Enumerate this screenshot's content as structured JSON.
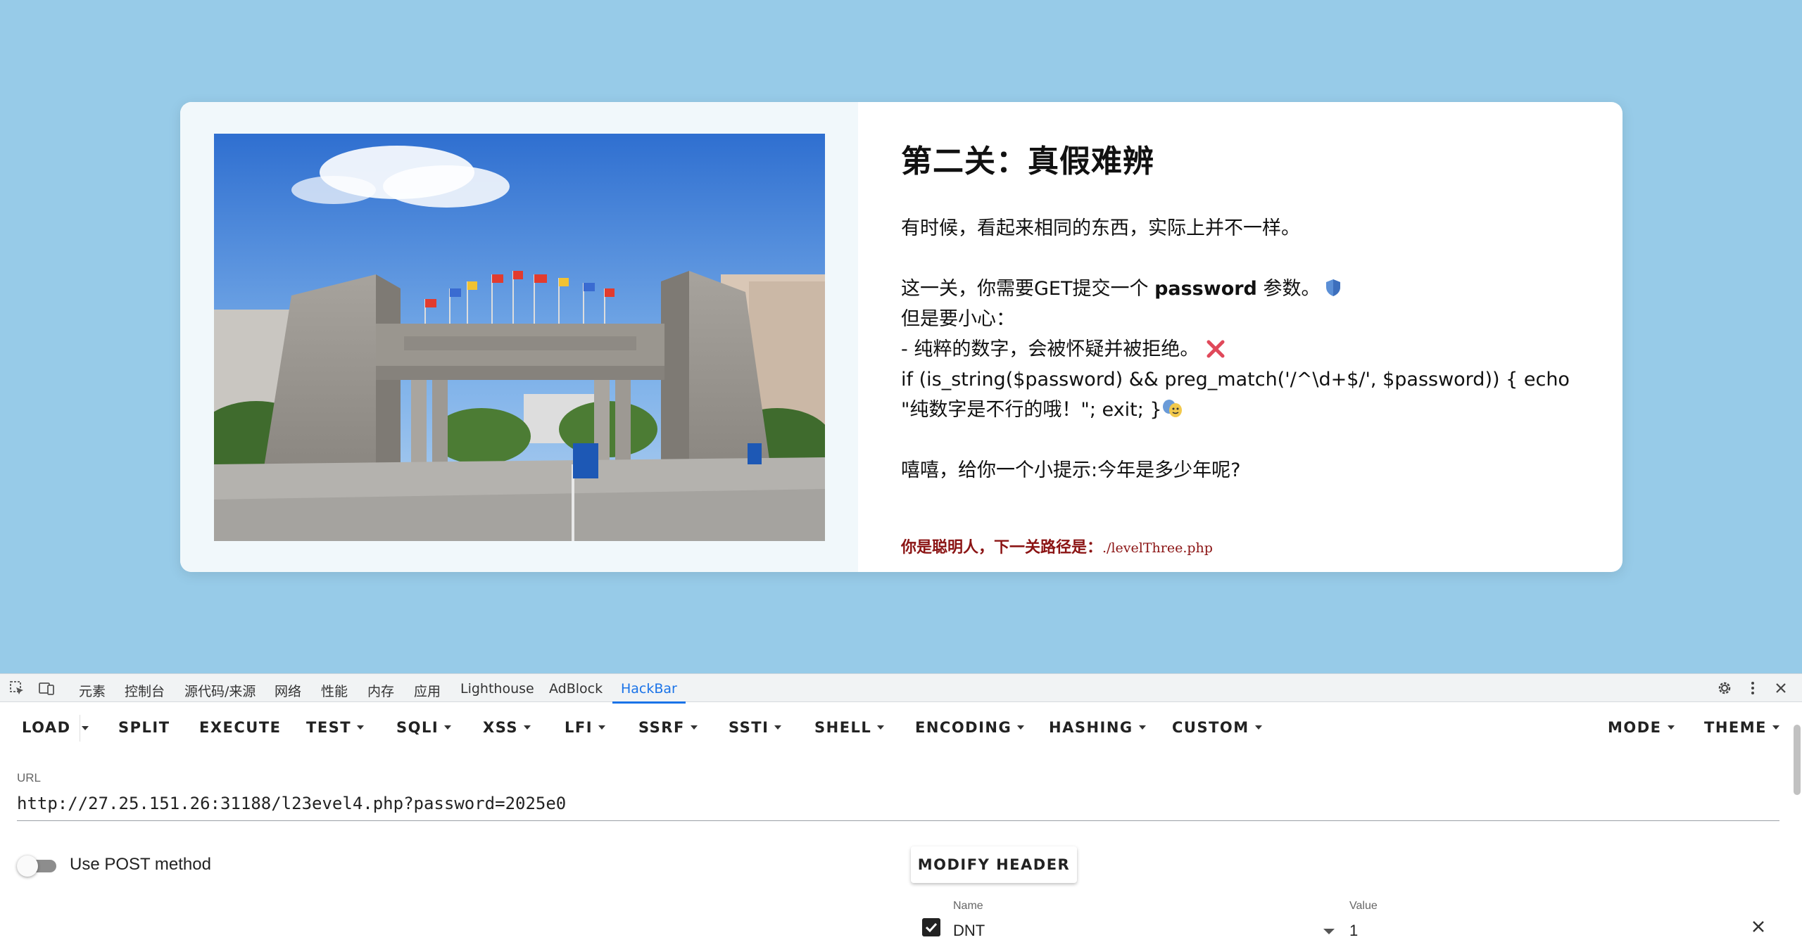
{
  "page": {
    "title": "第二关：真假难辨",
    "intro": "有时候，看起来相同的东西，实际上并不一样。",
    "instruction_prefix": "这一关，你需要GET提交一个 ",
    "instruction_keyword": "password",
    "instruction_suffix": " 参数。",
    "caution": "但是要小心：",
    "rule": "- 纯粹的数字，会被怀疑并被拒绝。",
    "code_line": "if (is_string($password) && preg_match('/^\\d+$/', $password)) { echo \"纯数字是不行的哦！\"; exit; }",
    "tip": "嘻嘻，给你一个小提示:今年是多少年呢?",
    "next_hint_label": "你是聪明人，下一关路径是：",
    "next_hint_path": "./levelThree.php",
    "photo_icon": "campus-gate-photo"
  },
  "devtools": {
    "tabs": [
      "元素",
      "控制台",
      "源代码/来源",
      "网络",
      "性能",
      "内存",
      "应用",
      "Lighthouse",
      "AdBlock",
      "HackBar"
    ],
    "active_tab": "HackBar",
    "icons": [
      "inspect-icon",
      "device-toolbar-icon",
      "settings-icon",
      "more-icon",
      "close-icon"
    ]
  },
  "hackbar": {
    "buttons": {
      "load": "LOAD",
      "split": "SPLIT",
      "execute": "EXECUTE",
      "test": "TEST",
      "sqli": "SQLI",
      "xss": "XSS",
      "lfi": "LFI",
      "ssrf": "SSRF",
      "ssti": "SSTI",
      "shell": "SHELL",
      "encoding": "ENCODING",
      "hashing": "HASHING",
      "custom": "CUSTOM",
      "mode": "MODE",
      "theme": "THEME"
    },
    "url_label": "URL",
    "url_value": "http://27.25.151.26:31188/l23evel4.php?password=2025e0",
    "post_label": "Use POST method",
    "post_enabled": false,
    "modify_header": "MODIFY HEADER",
    "header": {
      "name_label": "Name",
      "name": "DNT",
      "value_label": "Value",
      "value": "1",
      "enabled": true
    }
  },
  "colors": {
    "page_background": "#97cbe8",
    "hint_color": "#8b1414",
    "active_tab": "#1a73e8"
  }
}
